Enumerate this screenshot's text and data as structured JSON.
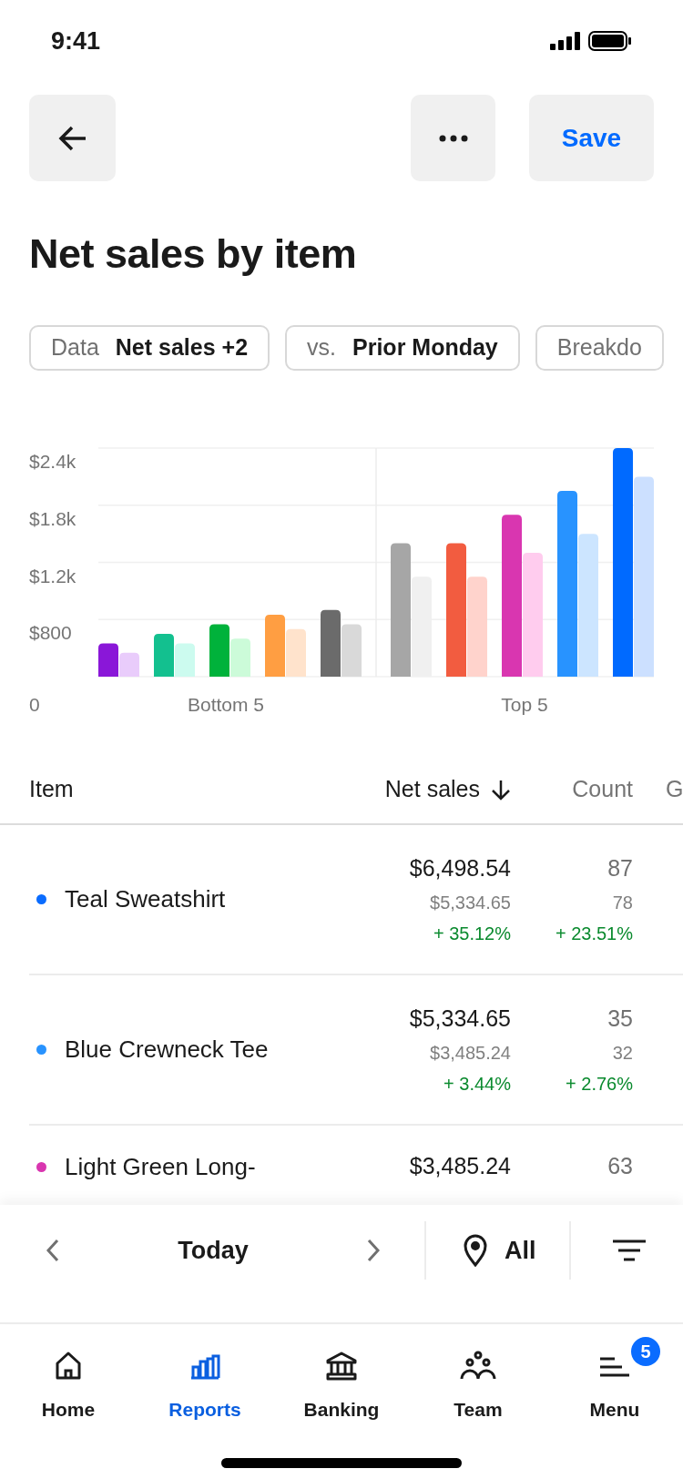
{
  "status_bar": {
    "time": "9:41"
  },
  "header": {
    "save_label": "Save"
  },
  "title": "Net sales by item",
  "filters": [
    {
      "label": "Data",
      "value": "Net sales +2"
    },
    {
      "label": "vs.",
      "value": "Prior Monday"
    },
    {
      "label": "Breakdo"
    }
  ],
  "chart": {
    "groups": [
      "Bottom 5",
      "Top 5"
    ],
    "extra_axis_labels": [
      "$800",
      "0"
    ],
    "chart_data": {
      "type": "bar",
      "ylim": [
        0,
        2400
      ],
      "yticks": [
        {
          "value": 1200,
          "label": "$1.2k"
        },
        {
          "value": 1800,
          "label": "$1.8k"
        },
        {
          "value": 2400,
          "label": "$2.4k"
        }
      ],
      "series": [
        {
          "values": [
            350,
            450,
            550,
            650,
            700,
            1400,
            1400,
            1700,
            1950,
            2400
          ],
          "colors": [
            "#8a17d8",
            "#13c08f",
            "#00b23b",
            "#ff9e42",
            "#6b6b6b",
            "#a6a6a6",
            "#f25c40",
            "#d936b0",
            "#2893ff",
            "#006aff"
          ]
        },
        {
          "values": [
            250,
            350,
            400,
            500,
            550,
            1050,
            1050,
            1300,
            1500,
            2100
          ],
          "colors": [
            "#e9ccfb",
            "#ccfbef",
            "#ccfbd9",
            "#ffe3cc",
            "#d9d9d9",
            "#f0f0f0",
            "#ffd3cc",
            "#ffccee",
            "#cce5ff",
            "#cce0ff"
          ]
        }
      ]
    }
  },
  "table": {
    "columns": [
      {
        "label": "Item",
        "sorted": false
      },
      {
        "label": "Net sales",
        "sorted": true
      },
      {
        "label": "Count",
        "sorted": false
      },
      {
        "label": "G",
        "sorted": false
      }
    ],
    "rows": [
      {
        "item": "Teal Sweatshirt",
        "color": "#0a6cff",
        "net_sales": "$6,498.54",
        "net_sales_prior": "$5,334.65",
        "net_sales_change": "+ 35.12%",
        "count": "87",
        "count_prior": "78",
        "count_change": "+ 23.51%"
      },
      {
        "item": "Blue Crewneck Tee",
        "color": "#2893ff",
        "net_sales": "$5,334.65",
        "net_sales_prior": "$3,485.24",
        "net_sales_change": "+ 3.44%",
        "count": "35",
        "count_prior": "32",
        "count_change": "+ 2.76%"
      },
      {
        "item": "Light Green Long-",
        "color": "#d936b0",
        "net_sales": "$3,485.24",
        "count": "63"
      }
    ]
  },
  "footer": {
    "period": "Today",
    "location": "All"
  },
  "tab_bar": [
    {
      "label": "Home",
      "selected": false
    },
    {
      "label": "Reports",
      "selected": true
    },
    {
      "label": "Banking",
      "selected": false
    },
    {
      "label": "Team",
      "selected": false
    },
    {
      "label": "Menu",
      "selected": false,
      "badge": "5"
    }
  ]
}
